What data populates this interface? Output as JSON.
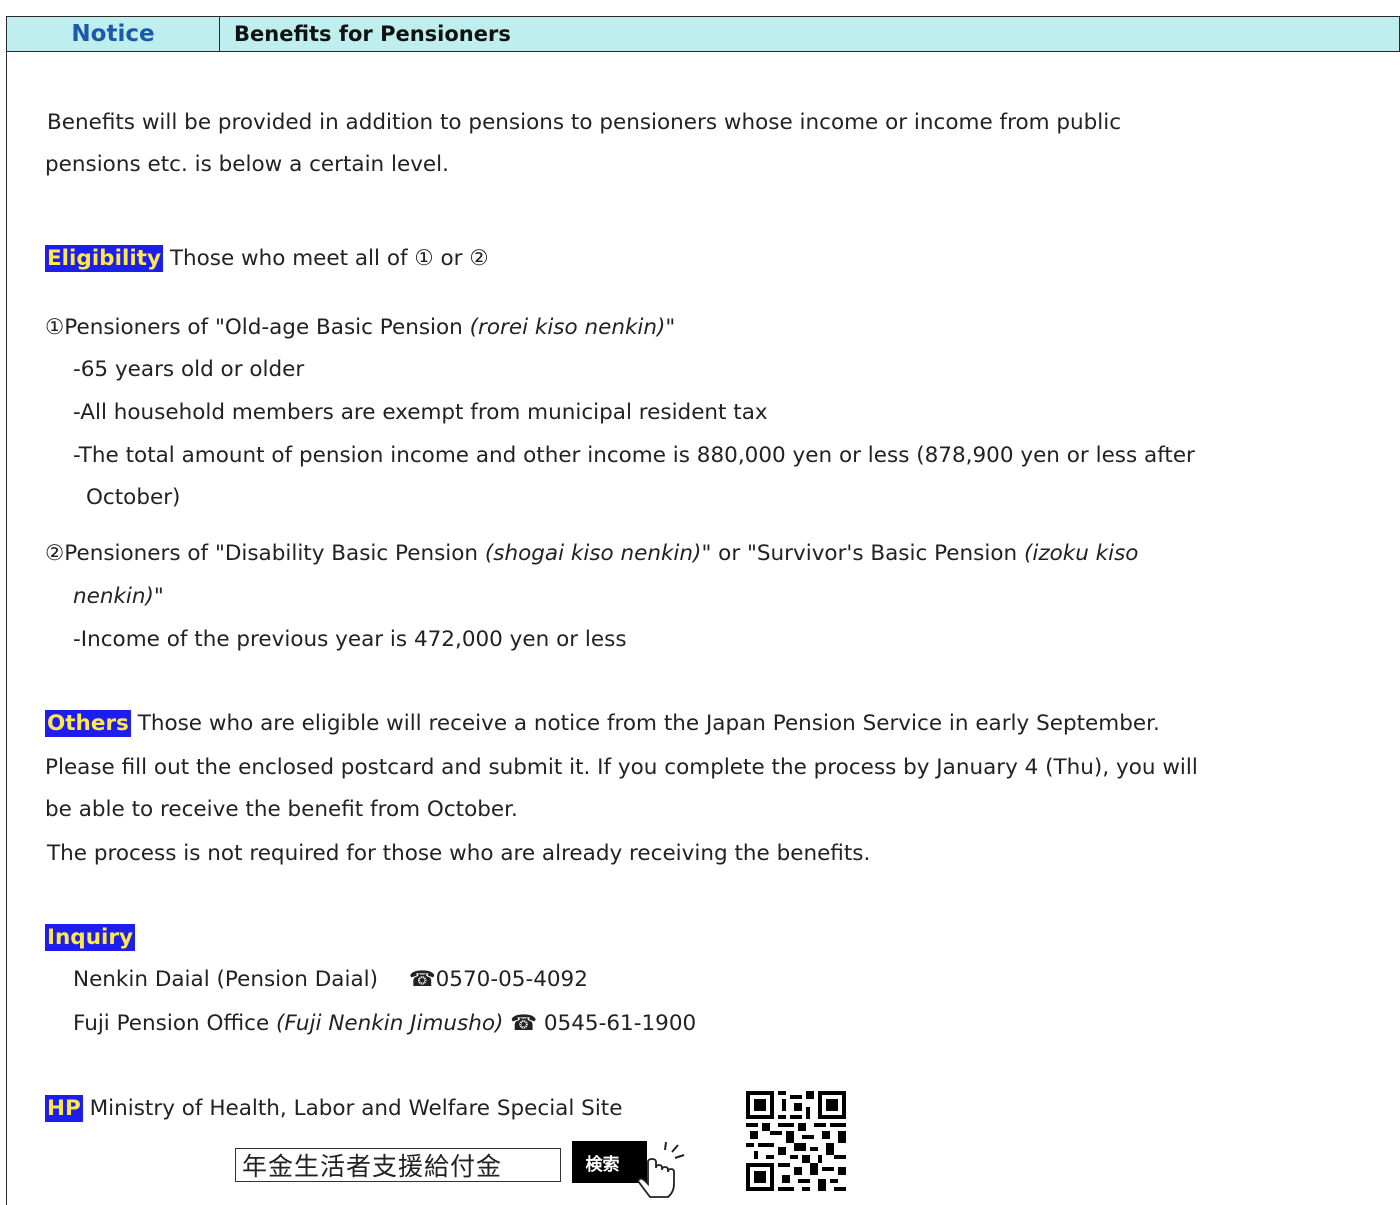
{
  "header": {
    "notice_label": "Notice",
    "title": "Benefits for Pensioners"
  },
  "intro": {
    "line1": " Benefits will be provided in addition to pensions to pensioners whose income or income from public",
    "line2": "pensions etc. is below a certain level."
  },
  "eligibility": {
    "label": "Eligibility",
    "text": "Those who meet all of  ①  or  ②",
    "group1": {
      "heading_pre": "①Pensioners of \"Old-age Basic Pension ",
      "heading_italic": "(rorei kiso nenkin)",
      "heading_post": "\"",
      "items": [
        "-65 years old or older",
        "-All household members are exempt from municipal resident tax",
        "-The total amount of pension income and other income is 880,000 yen or less (878,900 yen or less after"
      ],
      "items_cont": "October)"
    },
    "group2": {
      "heading_pre": "②Pensioners of \"Disability Basic Pension ",
      "heading_italic1": "(shogai kiso nenkin)",
      "heading_mid": "\" or \"Survivor's Basic Pension ",
      "heading_italic2a": "(izoku kiso",
      "heading_italic2b": "nenkin)",
      "heading_post": "\"",
      "items": [
        "-Income of the previous year is 472,000 yen or less"
      ]
    }
  },
  "others": {
    "label": "Others",
    "line1": "Those who are eligible will receive a notice from the Japan Pension Service in early September.",
    "line2": "Please fill out the enclosed postcard and submit it. If you complete the process by January 4 (Thu), you will",
    "line3": "be able to receive the benefit from October.",
    "line4": " The process is not required for those who are already receiving the benefits."
  },
  "inquiry": {
    "label": "Inquiry",
    "contact1_name": "Nenkin Daial (Pension Daial)",
    "contact1_phone": "☎0570-05-4092",
    "contact2_name": "Fuji Pension Office ",
    "contact2_italic": "(Fuji Nenkin Jimusho)",
    "contact2_phone": " ☎  0545-61-1900"
  },
  "hp": {
    "label": "HP",
    "text": "Ministry of Health, Labor and Welfare Special Site",
    "search_term": "年金生活者支援給付金",
    "search_button": "検索"
  }
}
